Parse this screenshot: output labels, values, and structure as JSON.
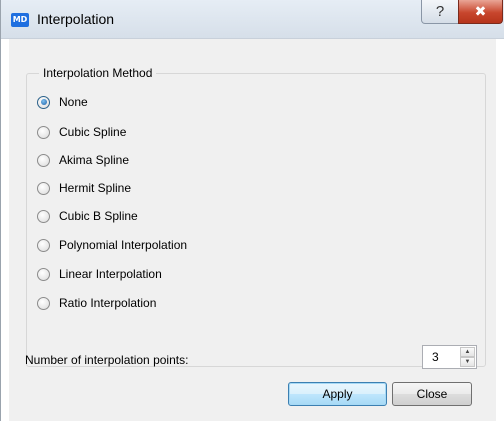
{
  "window": {
    "title": "Interpolation",
    "app_icon_text": "MD",
    "help_glyph": "?",
    "close_glyph": "✖"
  },
  "group": {
    "label": "Interpolation Method",
    "options": [
      {
        "label": "None",
        "checked": true
      },
      {
        "label": "Cubic Spline",
        "checked": false
      },
      {
        "label": "Akima Spline",
        "checked": false
      },
      {
        "label": "Hermit Spline",
        "checked": false
      },
      {
        "label": "Cubic B Spline",
        "checked": false
      },
      {
        "label": "Polynomial Interpolation",
        "checked": false
      },
      {
        "label": "Linear Interpolation",
        "checked": false
      },
      {
        "label": "Ratio Interpolation",
        "checked": false
      }
    ]
  },
  "points": {
    "label": "Number of interpolation points:",
    "value": "3"
  },
  "buttons": {
    "apply": "Apply",
    "close": "Close"
  },
  "colors": {
    "accent": "#1f6fe0",
    "close_button": "#c8462d",
    "selected_radio": "#1c5fa5"
  }
}
